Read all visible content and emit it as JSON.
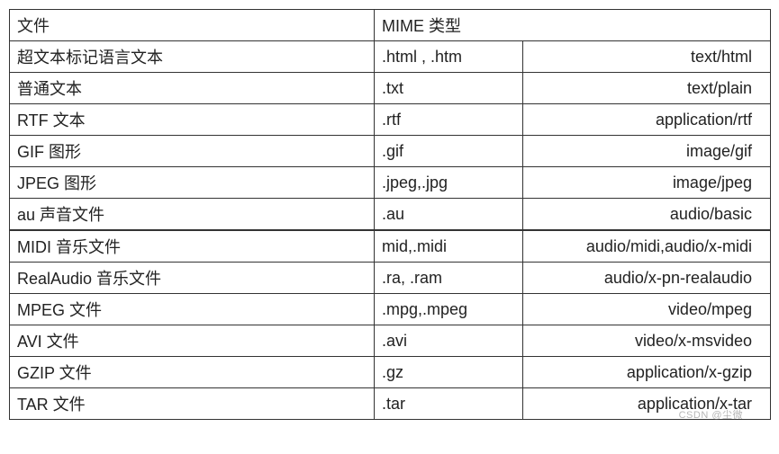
{
  "header": {
    "col1": "文件",
    "col2": "MIME 类型"
  },
  "rows": [
    {
      "file": "超文本标记语言文本",
      "ext": ".html , .htm",
      "mime": "text/html",
      "align": "right"
    },
    {
      "file": "普通文本",
      "ext": ".txt",
      "mime": "text/plain",
      "align": "right"
    },
    {
      "file": "RTF 文本",
      "ext": ".rtf",
      "mime": "application/rtf",
      "align": "right"
    },
    {
      "file": "GIF 图形",
      "ext": ".gif",
      "mime": "image/gif",
      "align": "right"
    },
    {
      "file": "JPEG 图形",
      "ext": ".jpeg,.jpg",
      "mime": "image/jpeg",
      "align": "right"
    },
    {
      "file": "au 声音文件",
      "ext": ".au",
      "mime": "audio/basic",
      "align": "right"
    },
    {
      "file": "MIDI 音乐文件",
      "ext": "mid,.midi",
      "mime": "audio/midi,audio/x-midi",
      "align": "right",
      "sep": true
    },
    {
      "file": "RealAudio 音乐文件",
      "ext": ".ra, .ram",
      "mime": "audio/x-pn-realaudio",
      "align": "right"
    },
    {
      "file": "MPEG 文件",
      "ext": ".mpg,.mpeg",
      "mime": "video/mpeg",
      "align": "right"
    },
    {
      "file": "AVI 文件",
      "ext": ".avi",
      "mime": "video/x-msvideo",
      "align": "right"
    },
    {
      "file": "GZIP 文件",
      "ext": ".gz",
      "mime": "application/x-gzip",
      "align": "right"
    },
    {
      "file": "TAR 文件",
      "ext": ".tar",
      "mime": "application/x-tar",
      "align": "right"
    }
  ],
  "watermark": "CSDN @尘微"
}
